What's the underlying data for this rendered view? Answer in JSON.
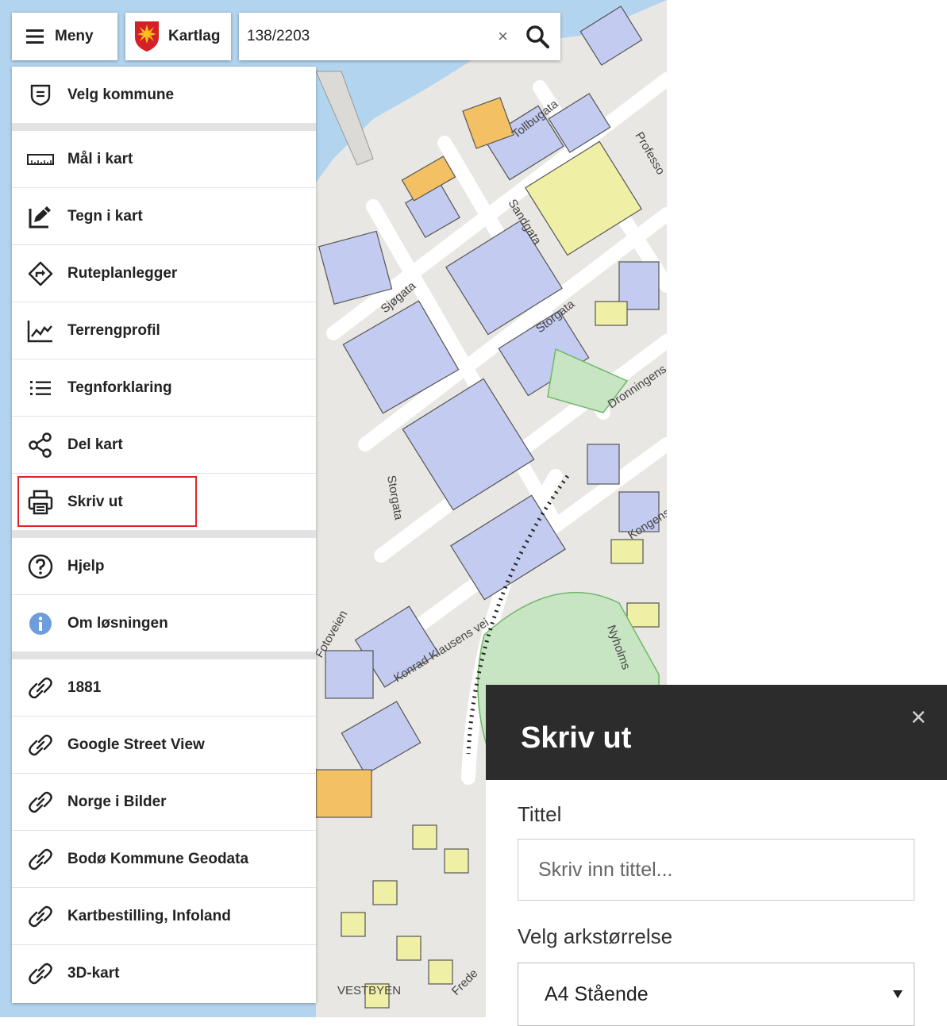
{
  "topbar": {
    "menu_label": "Meny",
    "layers_label": "Kartlag",
    "search_value": "138/2203",
    "clear_symbol": "×"
  },
  "menu": {
    "items": [
      {
        "label": "Velg kommune",
        "icon": "shield-outline-icon"
      },
      {
        "label": "Mål i kart",
        "icon": "ruler-icon"
      },
      {
        "label": "Tegn i kart",
        "icon": "draw-icon"
      },
      {
        "label": "Ruteplanlegger",
        "icon": "route-icon"
      },
      {
        "label": "Terrengprofil",
        "icon": "terrain-profile-icon"
      },
      {
        "label": "Tegnforklaring",
        "icon": "legend-list-icon"
      },
      {
        "label": "Del kart",
        "icon": "share-icon"
      },
      {
        "label": "Skriv ut",
        "icon": "print-icon"
      },
      {
        "label": "Hjelp",
        "icon": "help-icon"
      },
      {
        "label": "Om løsningen",
        "icon": "info-icon"
      },
      {
        "label": "1881",
        "icon": "link-icon"
      },
      {
        "label": "Google Street View",
        "icon": "link-icon"
      },
      {
        "label": "Norge i Bilder",
        "icon": "link-icon"
      },
      {
        "label": "Bodø Kommune Geodata",
        "icon": "link-icon"
      },
      {
        "label": "Kartbestilling, Infoland",
        "icon": "link-icon"
      },
      {
        "label": "3D-kart",
        "icon": "link-icon"
      }
    ]
  },
  "map": {
    "street_labels": [
      "Tollbugata",
      "Professo",
      "Sandgata",
      "Sjøgata",
      "Storgata",
      "Storgata",
      "Dronningens",
      "Kongens",
      "Konrad Klausens vei",
      "Nyholms",
      "Fotoveien",
      "VESTBYEN",
      "Frede"
    ]
  },
  "print_dialog": {
    "title": "Skriv ut",
    "close_symbol": "×",
    "title_label": "Tittel",
    "title_placeholder": "Skriv inn tittel...",
    "size_label": "Velg arkstørrelse",
    "size_value": "A4 Stående"
  },
  "colors": {
    "water": "#b3d4ef",
    "building": "#c3cbf0",
    "highlight_border": "#e2222a",
    "dialog_header": "#2c2c2c"
  }
}
